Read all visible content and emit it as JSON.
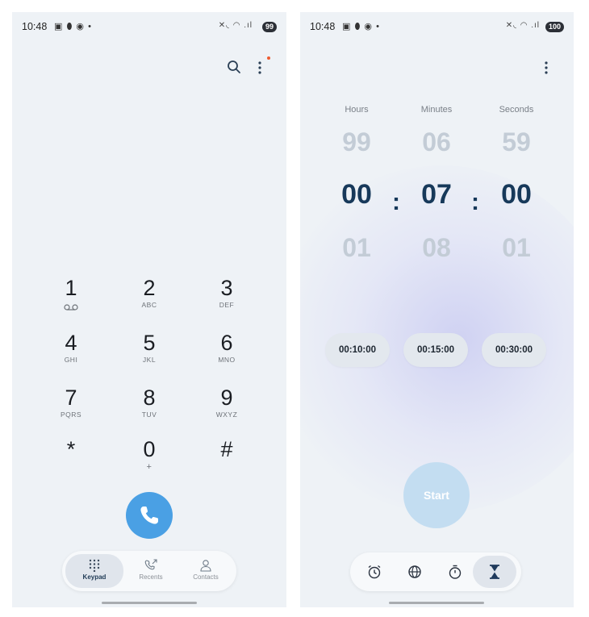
{
  "left": {
    "status": {
      "time": "10:48",
      "battery": "99"
    },
    "keypad": [
      {
        "digit": "1",
        "letters": ""
      },
      {
        "digit": "2",
        "letters": "ABC"
      },
      {
        "digit": "3",
        "letters": "DEF"
      },
      {
        "digit": "4",
        "letters": "GHI"
      },
      {
        "digit": "5",
        "letters": "JKL"
      },
      {
        "digit": "6",
        "letters": "MNO"
      },
      {
        "digit": "7",
        "letters": "PQRS"
      },
      {
        "digit": "8",
        "letters": "TUV"
      },
      {
        "digit": "9",
        "letters": "WXYZ"
      },
      {
        "digit": "*",
        "letters": ""
      },
      {
        "digit": "0",
        "letters": "+"
      },
      {
        "digit": "#",
        "letters": ""
      }
    ],
    "nav": {
      "keypad": "Keypad",
      "recents": "Recents",
      "contacts": "Contacts"
    }
  },
  "right": {
    "status": {
      "time": "10:48",
      "battery": "100"
    },
    "columns": {
      "hours_label": "Hours",
      "minutes_label": "Minutes",
      "seconds_label": "Seconds"
    },
    "picker": {
      "hours": {
        "prev": "99",
        "current": "00",
        "next": "01"
      },
      "minutes": {
        "prev": "06",
        "current": "07",
        "next": "08"
      },
      "seconds": {
        "prev": "59",
        "current": "00",
        "next": "01"
      },
      "separator": ":"
    },
    "presets": [
      "00:10:00",
      "00:15:00",
      "00:30:00"
    ],
    "start_label": "Start"
  },
  "colors": {
    "call": "#4aa0e4",
    "accent": "#17395a",
    "start": "#c3ddf1"
  }
}
